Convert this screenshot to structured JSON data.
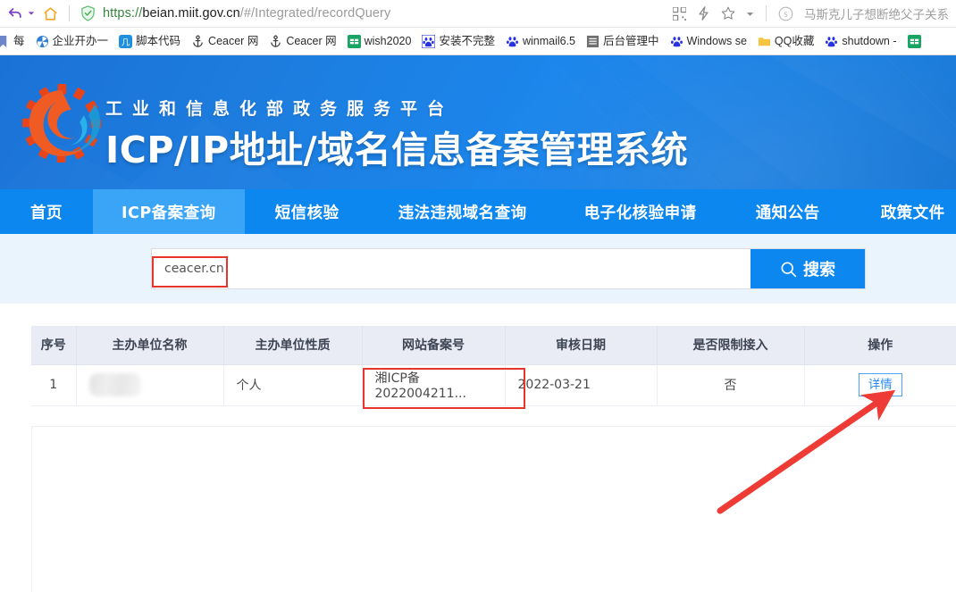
{
  "browser": {
    "url": {
      "scheme": "https://",
      "host": "beian.miit.gov.cn",
      "path": "/#/Integrated/recordQuery"
    },
    "icons": {
      "back": "back-arrow-icon",
      "home": "home-icon",
      "shield": "security-shield-icon",
      "apps": "apps-grid-icon",
      "lightning": "lightning-icon",
      "star": "bookmark-star-icon",
      "caret": "chevron-down-icon",
      "sogou": "sogou-icon"
    },
    "news_title": "马斯克儿子想断绝父子关系",
    "bookmarks": [
      {
        "label": "每",
        "icon": "bookmark-icon"
      },
      {
        "label": "企业开办一",
        "icon": "pinwheel-icon"
      },
      {
        "label": "脚本代码",
        "icon": "blue-square-icon"
      },
      {
        "label": "Ceacer 网",
        "icon": "anchor-icon"
      },
      {
        "label": "Ceacer 网",
        "icon": "anchor-icon"
      },
      {
        "label": "wish2020",
        "icon": "green-sheet-icon"
      },
      {
        "label": "安装不完整",
        "icon": "baidu-paw-icon"
      },
      {
        "label": "winmail6.5",
        "icon": "baidu-paw-icon"
      },
      {
        "label": "后台管理中",
        "icon": "gray-doc-icon"
      },
      {
        "label": "Windows se",
        "icon": "baidu-paw-icon"
      },
      {
        "label": "QQ收藏",
        "icon": "folder-icon"
      },
      {
        "label": "shutdown -",
        "icon": "baidu-paw-icon"
      },
      {
        "label": "",
        "icon": "green-sheet-icon"
      }
    ]
  },
  "banner": {
    "subtitle": "工业和信息化部政务服务平台",
    "title": "ICP/IP地址/域名信息备案管理系统",
    "logo_icon": "miit-gear-logo-icon"
  },
  "nav": {
    "items": [
      {
        "label": "首页",
        "active": false
      },
      {
        "label": "ICP备案查询",
        "active": true
      },
      {
        "label": "短信核验",
        "active": false
      },
      {
        "label": "违法违规域名查询",
        "active": false
      },
      {
        "label": "电子化核验申请",
        "active": false
      },
      {
        "label": "通知公告",
        "active": false
      },
      {
        "label": "政策文件",
        "active": false
      }
    ]
  },
  "search": {
    "value": "ceacer.cn",
    "placeholder": "",
    "button_label": "搜索",
    "button_icon": "search-icon"
  },
  "table": {
    "columns": [
      "序号",
      "主办单位名称",
      "主办单位性质",
      "网站备案号",
      "审核日期",
      "是否限制接入",
      "操作"
    ],
    "rows": [
      {
        "index": "1",
        "sponsor_name": "",
        "sponsor_name_redacted": true,
        "sponsor_type": "个人",
        "record_number": "湘ICP备2022004211...",
        "review_date": "2022-03-21",
        "restricted": "否",
        "action_label": "详情"
      }
    ]
  },
  "annotations": {
    "search_box_color": "#e8352b",
    "record_box_color": "#e8352b",
    "arrow_color": "#ee3b35",
    "arrow_target": "详情"
  },
  "colors": {
    "nav_bg": "#0b87ef",
    "nav_active_bg": "#3aa5f7",
    "banner_blue": "#1b7ddf",
    "search_band_bg": "#eaf4fd",
    "table_header_bg": "#e9ecf4",
    "detail_button_border": "#4aa3f5",
    "detail_button_text": "#2b8cf0"
  }
}
